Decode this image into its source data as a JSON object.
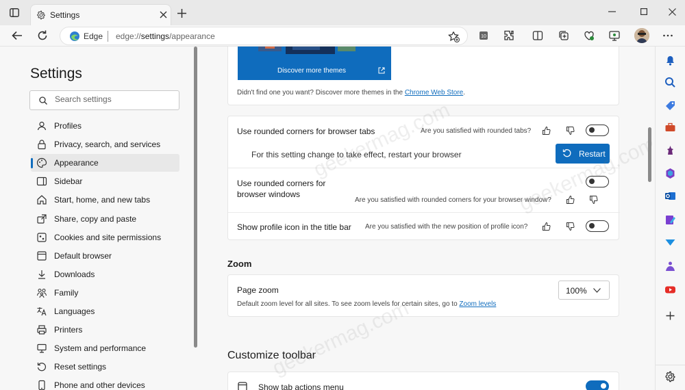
{
  "window": {
    "tab_title": "Settings",
    "new_tab_label": "+"
  },
  "address_bar": {
    "brand": "Edge",
    "url_prefix": "edge://",
    "url_host": "settings",
    "url_path": "/appearance"
  },
  "sidebar": {
    "title": "Settings",
    "search_placeholder": "Search settings",
    "items": [
      {
        "label": "Profiles",
        "icon": "profile-icon"
      },
      {
        "label": "Privacy, search, and services",
        "icon": "lock-icon"
      },
      {
        "label": "Appearance",
        "icon": "palette-icon",
        "active": true
      },
      {
        "label": "Sidebar",
        "icon": "sidebar-icon"
      },
      {
        "label": "Start, home, and new tabs",
        "icon": "home-icon"
      },
      {
        "label": "Share, copy and paste",
        "icon": "share-icon"
      },
      {
        "label": "Cookies and site permissions",
        "icon": "cookie-icon"
      },
      {
        "label": "Default browser",
        "icon": "browser-icon"
      },
      {
        "label": "Downloads",
        "icon": "download-icon"
      },
      {
        "label": "Family",
        "icon": "family-icon"
      },
      {
        "label": "Languages",
        "icon": "language-icon"
      },
      {
        "label": "Printers",
        "icon": "printer-icon"
      },
      {
        "label": "System and performance",
        "icon": "system-icon"
      },
      {
        "label": "Reset settings",
        "icon": "reset-icon"
      },
      {
        "label": "Phone and other devices",
        "icon": "phone-icon"
      }
    ]
  },
  "themes": {
    "discover_label": "Discover more themes",
    "store_text": "Didn't find one you want? Discover more themes in the ",
    "store_link": "Chrome Web Store",
    "store_suffix": "."
  },
  "appearance_options": {
    "rounded_tabs": {
      "label": "Use rounded corners for browser tabs",
      "feedback": "Are you satisfied with rounded tabs?",
      "enabled": false,
      "restart_note": "For this setting change to take effect, restart your browser",
      "restart_button": "Restart"
    },
    "rounded_windows": {
      "label": "Use rounded corners for browser windows",
      "feedback": "Are you satisfied with rounded corners for your browser window?",
      "enabled": false
    },
    "profile_icon": {
      "label": "Show profile icon in the title bar",
      "feedback": "Are you satisfied with the new position of profile icon?",
      "enabled": false
    }
  },
  "zoom": {
    "section_title": "Zoom",
    "page_zoom_label": "Page zoom",
    "page_zoom_desc": "Default zoom level for all sites. To see zoom levels for certain sites, go to ",
    "zoom_levels_link": "Zoom levels",
    "value": "100%"
  },
  "customize_toolbar": {
    "section_title": "Customize toolbar",
    "tab_actions_label": "Show tab actions menu",
    "tab_actions_enabled": true
  },
  "watermark": "geekermag.com",
  "colors": {
    "accent": "#0f6cbd",
    "theme_card": "#0f6cbd"
  }
}
